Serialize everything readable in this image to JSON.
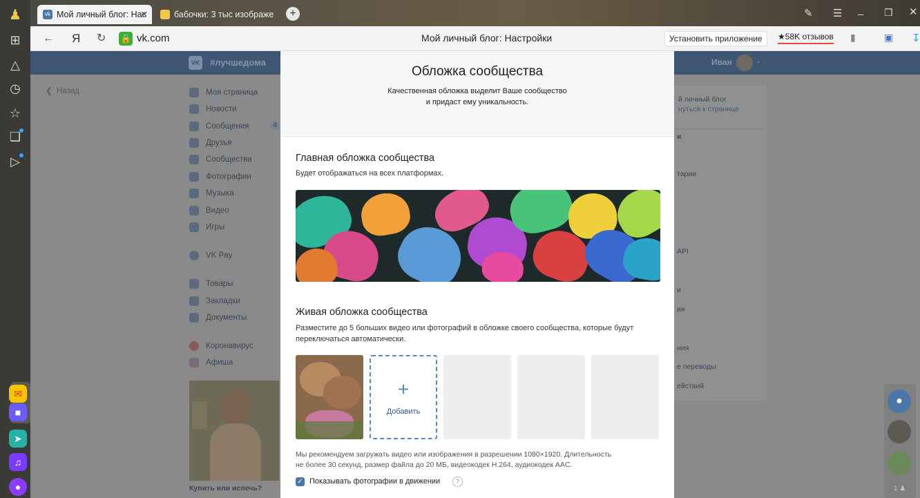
{
  "browser": {
    "tabs": [
      {
        "title": "Мой личный блог: Нас"
      },
      {
        "title": "бабочки: 3 тыс изображе"
      }
    ],
    "address": "vk.com",
    "page_title": "Мой личный блог: Настройки",
    "install_app_label": "Установить приложение",
    "reviews_label": "★58K отзывов",
    "yandex_letter": "Я"
  },
  "vk": {
    "header_hashtag": "#лучшедома",
    "user_name": "Иван",
    "back_label": "Назад",
    "menu": [
      {
        "label": "Моя страница"
      },
      {
        "label": "Новости"
      },
      {
        "label": "Сообщения",
        "badge": "4"
      },
      {
        "label": "Друзья"
      },
      {
        "label": "Сообщества"
      },
      {
        "label": "Фотографии"
      },
      {
        "label": "Музыка"
      },
      {
        "label": "Видео"
      },
      {
        "label": "Игры"
      },
      {
        "label": "VK Pay"
      },
      {
        "label": "Товары"
      },
      {
        "label": "Закладки"
      },
      {
        "label": "Документы"
      },
      {
        "label": "Коронавирус"
      },
      {
        "label": "Афиша"
      }
    ],
    "ad_caption": "Купить или испечь?",
    "right_panel": {
      "line1": "й личный блог",
      "line2": "нуться к странице",
      "sec": "и",
      "items": [
        "тарии",
        "API",
        "и",
        "ия",
        "ния",
        "е переводы",
        "ействий"
      ]
    }
  },
  "modal": {
    "title": "Обложка сообщества",
    "subtitle_line1": "Качественная обложка выделит Ваше сообщество",
    "subtitle_line2": "и придаст ему уникальность.",
    "main_cover_title": "Главная обложка сообщества",
    "main_cover_desc": "Будет отображаться на всех платформах.",
    "live_cover_title": "Живая обложка сообщества",
    "live_cover_desc_line1": "Разместите до 5 больших видео или фотографий в обложке своего сообщества, которые будут",
    "live_cover_desc_line2": "переключаться автоматически.",
    "add_label": "Добавить",
    "rec_line1": "Мы рекомендуем загружать видео или изображения в разрешении 1080×1920. Длительность",
    "rec_line2": "не более 30 секунд, размер файла до 20 МБ, видеокодек H.264, аудиокодек AAC.",
    "checkbox_label": "Показывать фотографии в движении",
    "checkbox_checked": true,
    "help_mark": "?"
  },
  "right_dock": {
    "count_label": "1"
  },
  "colors": {
    "accent": "#4a76a8",
    "header": "#3f5672",
    "modal_bg": "#ffffff"
  }
}
